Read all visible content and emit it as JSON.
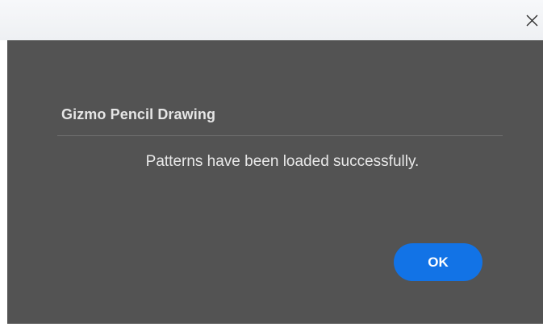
{
  "window": {
    "close_icon": "close-icon"
  },
  "dialog": {
    "title": "Gizmo Pencil Drawing",
    "message": "Patterns have been loaded successfully.",
    "ok_label": "OK"
  },
  "colors": {
    "dialog_background": "#535353",
    "accent": "#1273e6",
    "text": "#e8e8e8"
  }
}
